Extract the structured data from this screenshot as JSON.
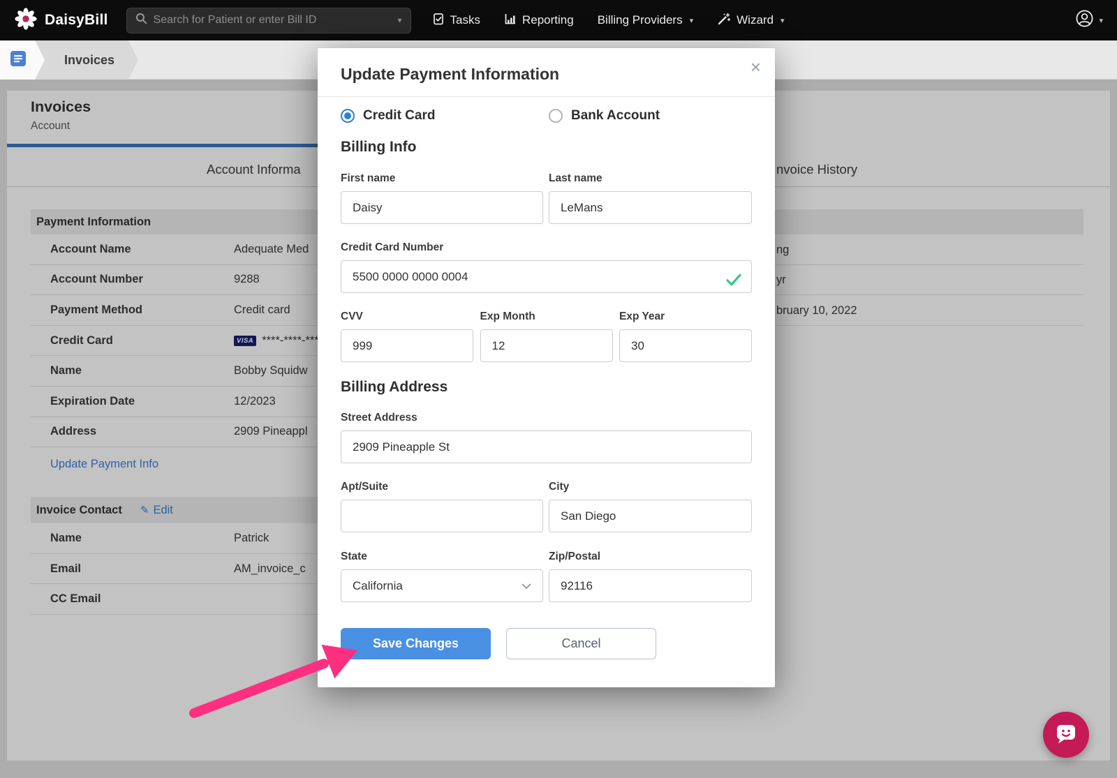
{
  "colors": {
    "accent_blue": "#4a90e2",
    "link_blue": "#3b7fd6",
    "header_rule_blue": "#3a78c2",
    "arrow_pink": "#ff2f80",
    "valid_green": "#3cc488",
    "chat_bubble": "#c41a56",
    "visa_badge": "#1a1f71",
    "navbar_bg": "#0c0c0c"
  },
  "navbar": {
    "brand": "DaisyBill",
    "search_placeholder": "Search for Patient or enter Bill ID",
    "tasks": "Tasks",
    "reporting": "Reporting",
    "billing_providers": "Billing Providers",
    "wizard": "Wizard"
  },
  "breadcrumb": {
    "current": "Invoices"
  },
  "page": {
    "title": "Invoices",
    "subtitle": "Account",
    "tabs": {
      "left_visible": "Account Informa",
      "right_visible": "nvoice History"
    },
    "payment_info": {
      "heading": "Payment Information",
      "rows": [
        {
          "label": "Account Name",
          "value": "Adequate Med"
        },
        {
          "label": "Account Number",
          "value": "9288"
        },
        {
          "label": "Payment Method",
          "value": "Credit card"
        },
        {
          "label": "Credit Card",
          "badge": "VISA",
          "value": "****-****-****"
        },
        {
          "label": "Name",
          "value": "Bobby Squidw"
        },
        {
          "label": "Expiration Date",
          "value": "12/2023"
        },
        {
          "label": "Address",
          "value": "2909 Pineappl"
        }
      ],
      "update_link": "Update Payment Info"
    },
    "invoice_contact": {
      "heading": "Invoice Contact",
      "edit_label": "Edit",
      "rows": [
        {
          "label": "Name",
          "value": "Patrick"
        },
        {
          "label": "Email",
          "value": "AM_invoice_c"
        },
        {
          "label": "CC Email",
          "value": ""
        }
      ]
    },
    "right_column_visible": [
      "ng",
      "yr",
      "bruary 10, 2022"
    ]
  },
  "modal": {
    "title": "Update Payment Information",
    "close_glyph": "×",
    "payment_type": {
      "credit_card": "Credit Card",
      "bank_account": "Bank Account",
      "selected": "Credit Card"
    },
    "billing_info": {
      "heading": "Billing Info",
      "first_name": {
        "label": "First name",
        "value": "Daisy"
      },
      "last_name": {
        "label": "Last name",
        "value": "LeMans"
      },
      "card_number": {
        "label": "Credit Card Number",
        "value": "5500 0000 0000 0004"
      },
      "cvv": {
        "label": "CVV",
        "value": "999"
      },
      "exp_month": {
        "label": "Exp Month",
        "value": "12"
      },
      "exp_year": {
        "label": "Exp Year",
        "value": "30"
      }
    },
    "billing_address": {
      "heading": "Billing Address",
      "street": {
        "label": "Street Address",
        "value": "2909 Pineapple St"
      },
      "apt": {
        "label": "Apt/Suite",
        "value": ""
      },
      "city": {
        "label": "City",
        "value": "San Diego"
      },
      "state": {
        "label": "State",
        "value": "California"
      },
      "zip": {
        "label": "Zip/Postal",
        "value": "92116"
      }
    },
    "save_label": "Save Changes",
    "cancel_label": "Cancel"
  }
}
